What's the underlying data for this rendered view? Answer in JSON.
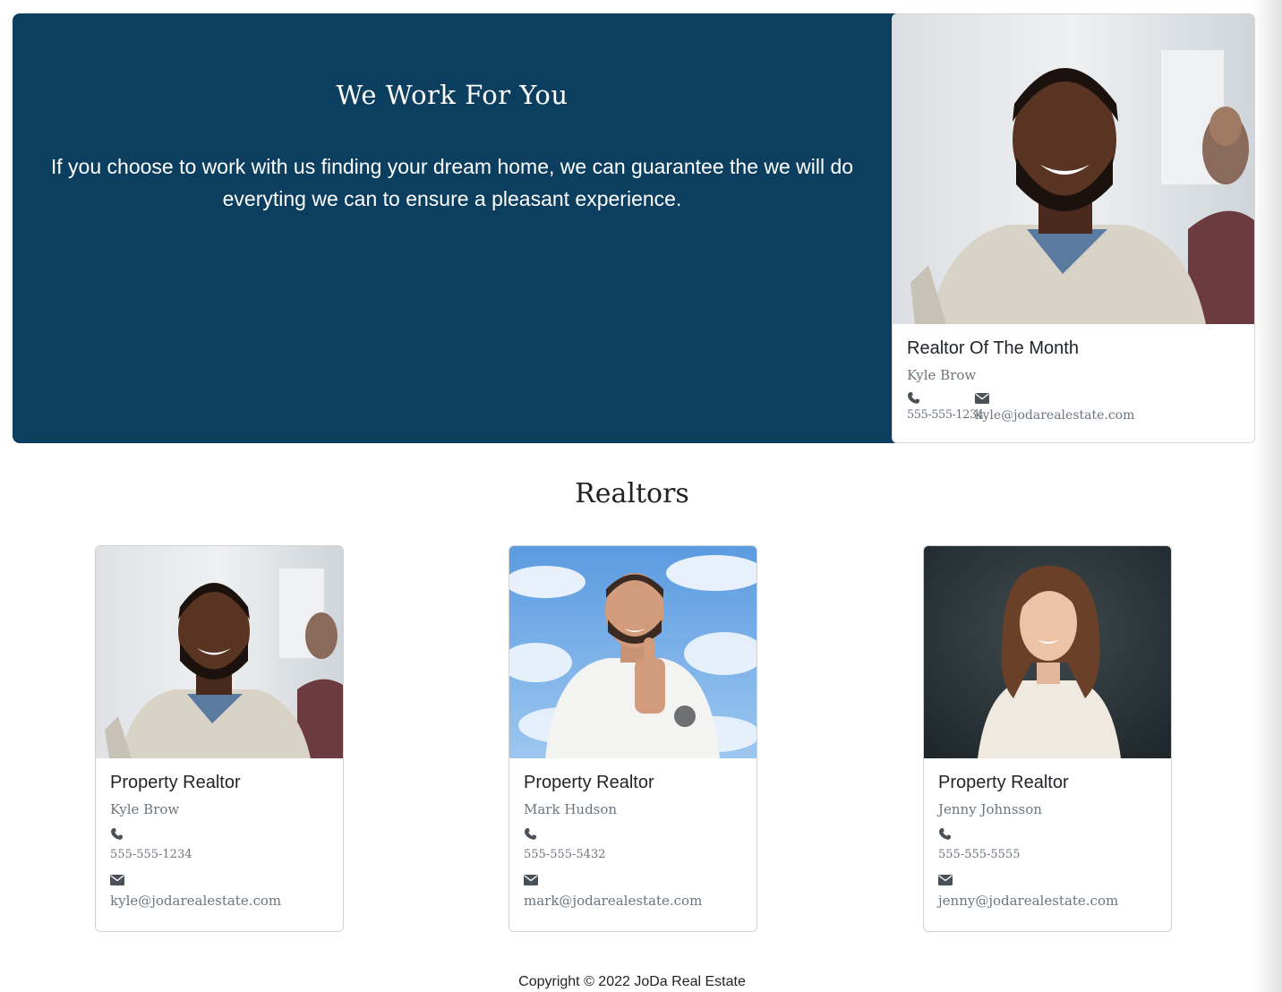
{
  "hero": {
    "title": "We Work For You",
    "body": "If you choose to work with us finding your dream home, we can guarantee the we will do everyting we can to ensure a pleasant experience.",
    "background_color": "#0c3f5f"
  },
  "realtor_of_month": {
    "title": "Realtor Of The Month",
    "name": "Kyle Brow",
    "phone": "555-555-1234",
    "email": "kyle@jodarealestate.com",
    "phone_icon": "phone-icon",
    "email_icon": "envelope-icon"
  },
  "realtors": {
    "heading": "Realtors",
    "cards": [
      {
        "title": "Property Realtor",
        "name": "Kyle Brow",
        "phone": "555-555-1234",
        "email": "kyle@jodarealestate.com"
      },
      {
        "title": "Property Realtor",
        "name": "Mark Hudson",
        "phone": "555-555-5432",
        "email": "mark@jodarealestate.com"
      },
      {
        "title": "Property Realtor",
        "name": "Jenny Johnsson",
        "phone": "555-555-5555",
        "email": "jenny@jodarealestate.com"
      }
    ]
  },
  "footer": {
    "copyright": "Copyright © 2022 JoDa Real Estate"
  }
}
